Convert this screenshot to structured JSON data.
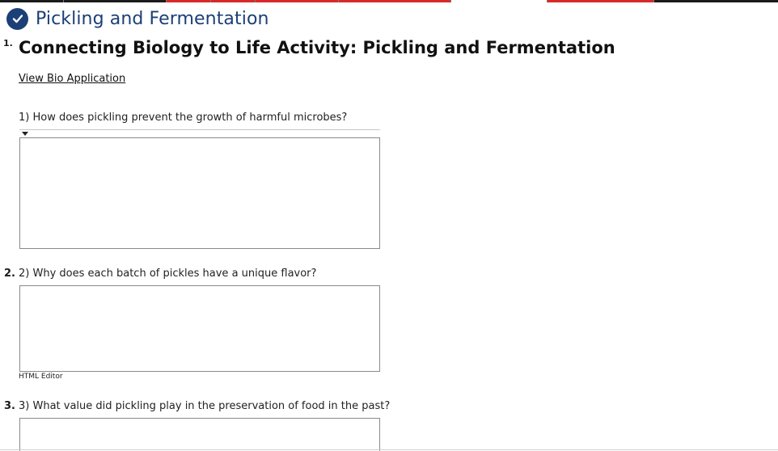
{
  "header": {
    "title": "Pickling and Fermentation",
    "icon": "check-circle-icon",
    "accent_color": "#1c3f77"
  },
  "progress_colors": {
    "complete": "#1b1b1b",
    "incorrect": "#d62a2a"
  },
  "activity": {
    "number": "1.",
    "title": "Connecting Biology to Life Activity: Pickling and Fermentation",
    "link_label": "View Bio Application"
  },
  "questions": [
    {
      "number": "",
      "text": "1) How does pickling prevent the growth of harmful microbes?",
      "answer": ""
    },
    {
      "number": "2.",
      "text": "2) Why does each batch of pickles have a unique flavor?",
      "answer": "",
      "editor_label": "HTML Editor"
    },
    {
      "number": "3.",
      "text": "3) What value did pickling play in the preservation of food in the past?",
      "answer": ""
    }
  ]
}
